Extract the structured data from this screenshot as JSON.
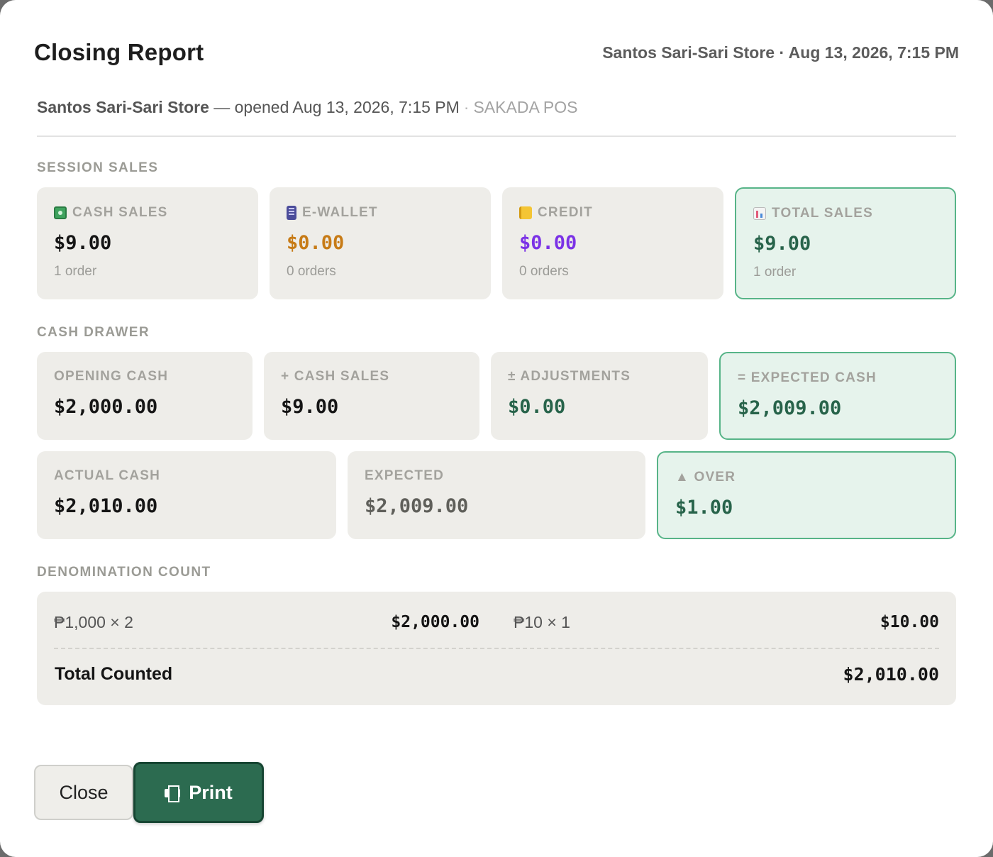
{
  "header": {
    "title": "Closing Report",
    "meta": "Santos Sari-Sari Store · Aug 13, 2026, 7:15 PM"
  },
  "subline": {
    "store": "Santos Sari-Sari Store",
    "opened": " — opened Aug 13, 2026, 7:15 PM",
    "separator": "·",
    "pos": "SAKADA POS"
  },
  "session_sales": {
    "title": "SESSION SALES",
    "cash": {
      "icon": "cash-icon",
      "label": "CASH SALES",
      "value": "$9.00",
      "sub": "1 order"
    },
    "ewallet": {
      "icon": "mobile-wallet-icon",
      "label": "E-WALLET",
      "value": "$0.00",
      "sub": "0 orders",
      "color": "#c77b16"
    },
    "credit": {
      "icon": "notebook-icon",
      "label": "CREDIT",
      "value": "$0.00",
      "sub": "0 orders",
      "color": "#7b32e6"
    },
    "total": {
      "icon": "bar-chart-icon",
      "label": "TOTAL SALES",
      "value": "$9.00",
      "sub": "1 order",
      "color": "#27634a"
    }
  },
  "cash_drawer": {
    "title": "CASH DRAWER",
    "opening": {
      "label": "OPENING CASH",
      "value": "$2,000.00"
    },
    "cash_sales": {
      "label": "+ CASH SALES",
      "value": "$9.00"
    },
    "adjustments": {
      "label": "± ADJUSTMENTS",
      "value": "$0.00"
    },
    "expected_cash": {
      "label": "= EXPECTED CASH",
      "value": "$2,009.00"
    },
    "actual": {
      "label": "ACTUAL CASH",
      "value": "$2,010.00"
    },
    "expected": {
      "label": "EXPECTED",
      "value": "$2,009.00"
    },
    "over": {
      "label": "▲ OVER",
      "value": "$1.00"
    }
  },
  "denomination": {
    "title": "DENOMINATION COUNT",
    "items": [
      {
        "label": "₱1,000 × 2",
        "amount": "$2,000.00"
      },
      {
        "label": "₱10 × 1",
        "amount": "$10.00"
      }
    ],
    "total_label": "Total Counted",
    "total_value": "$2,010.00"
  },
  "buttons": {
    "close": "Close",
    "print": "Print",
    "print_icon": "printer-icon"
  },
  "colors": {
    "accent_green": "#2c6b50",
    "highlight_bg": "#e6f3ec",
    "highlight_border": "#57b488",
    "card_bg": "#eeede9"
  }
}
